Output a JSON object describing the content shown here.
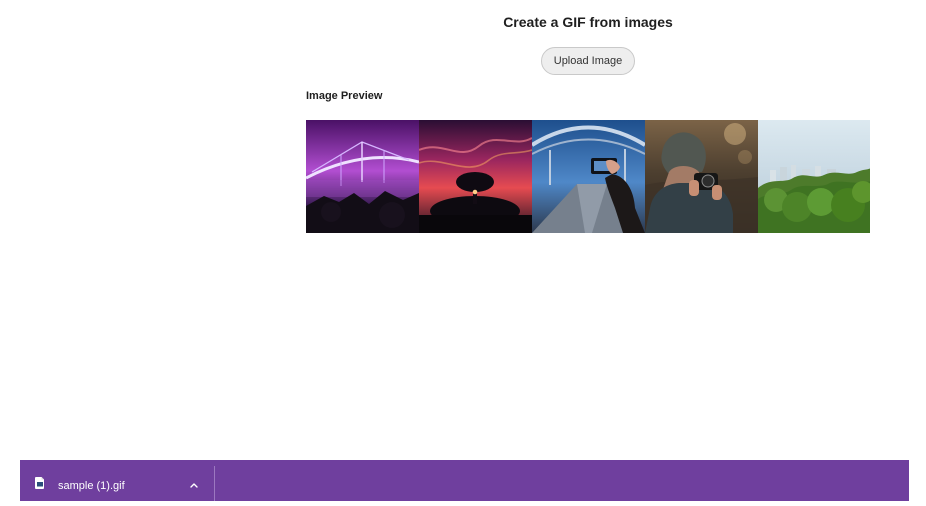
{
  "page": {
    "title": "Create a GIF from images",
    "upload_label": "Upload Image",
    "preview_label": "Image Preview"
  },
  "preview": {
    "images": [
      {
        "name": "bridge-night-image"
      },
      {
        "name": "sunset-tree-image"
      },
      {
        "name": "phone-photo-bridge-image"
      },
      {
        "name": "camera-photographer-image"
      },
      {
        "name": "green-forest-image"
      }
    ]
  },
  "download_bar": {
    "file_name": "sample (1).gif",
    "accent": "#6f3f9e",
    "icon": "file-icon",
    "chevron_icon": "chevron-up-icon"
  }
}
